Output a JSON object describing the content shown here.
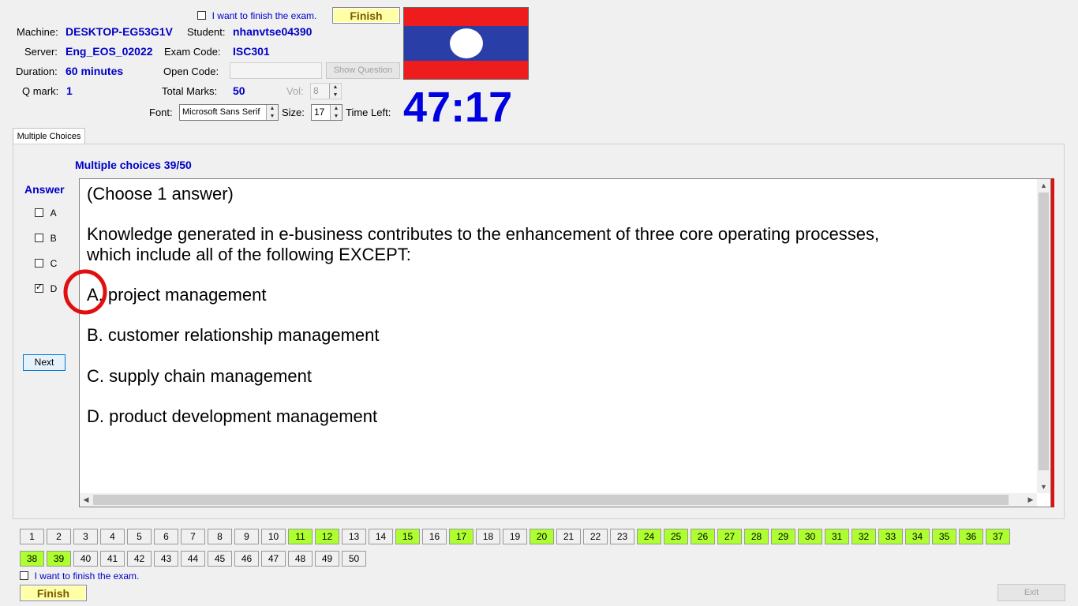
{
  "header": {
    "finish_checkbox_label": "I want to finish the exam.",
    "finish_button": "Finish",
    "machine_label": "Machine:",
    "machine_value": "DESKTOP-EG53G1V",
    "student_label": "Student:",
    "student_value": "nhanvtse04390",
    "server_label": "Server:",
    "server_value": "Eng_EOS_02022",
    "exam_code_label": "Exam Code:",
    "exam_code_value": "ISC301",
    "duration_label": "Duration:",
    "duration_value": "60 minutes",
    "open_code_label": "Open Code:",
    "open_code_value": "",
    "show_question_button": "Show Question",
    "qmark_label": "Q mark:",
    "qmark_value": "1",
    "total_marks_label": "Total Marks:",
    "total_marks_value": "50",
    "vol_label": "Vol:",
    "vol_value": "8",
    "font_label": "Font:",
    "font_value": "Microsoft Sans Serif",
    "size_label": "Size:",
    "size_value": "17",
    "time_left_label": "Time Left:",
    "time_left_value": "47:17",
    "flag_colors": {
      "red": "#ee1c1c",
      "blue": "#2a3ea8",
      "white": "#ffffff"
    }
  },
  "tab": {
    "label": "Multiple Choices"
  },
  "panel": {
    "title": "Multiple choices 39/50",
    "answer_label": "Answer",
    "options": [
      {
        "letter": "A",
        "checked": false
      },
      {
        "letter": "B",
        "checked": false
      },
      {
        "letter": "C",
        "checked": false
      },
      {
        "letter": "D",
        "checked": true
      }
    ],
    "next_button": "Next"
  },
  "question": {
    "instruction": "(Choose 1 answer)",
    "line1": "Knowledge generated in e-business contributes to the enhancement of three core operating processes,",
    "line2": "which include all of the following EXCEPT:",
    "answers": [
      "A.  project management",
      "B.  customer relationship management",
      "C.  supply chain management",
      "D.  product development management"
    ]
  },
  "navigator": {
    "questions": [
      "1",
      "2",
      "3",
      "4",
      "5",
      "6",
      "7",
      "8",
      "9",
      "10",
      "11",
      "12",
      "13",
      "14",
      "15",
      "16",
      "17",
      "18",
      "19",
      "20",
      "21",
      "22",
      "23",
      "24",
      "25",
      "26",
      "27",
      "28",
      "29",
      "30",
      "31",
      "32",
      "33",
      "34",
      "35",
      "36",
      "37",
      "38",
      "39",
      "40",
      "41",
      "42",
      "43",
      "44",
      "45",
      "46",
      "47",
      "48",
      "49",
      "50"
    ],
    "answered": [
      11,
      12,
      15,
      17,
      20,
      24,
      25,
      26,
      27,
      28,
      29,
      30,
      31,
      32,
      33,
      34,
      35,
      36,
      37,
      38,
      39
    ],
    "answered_color": "#adff2f"
  },
  "footer": {
    "finish_checkbox_label": "I want to finish the exam.",
    "finish_button": "Finish",
    "exit_button": "Exit"
  }
}
